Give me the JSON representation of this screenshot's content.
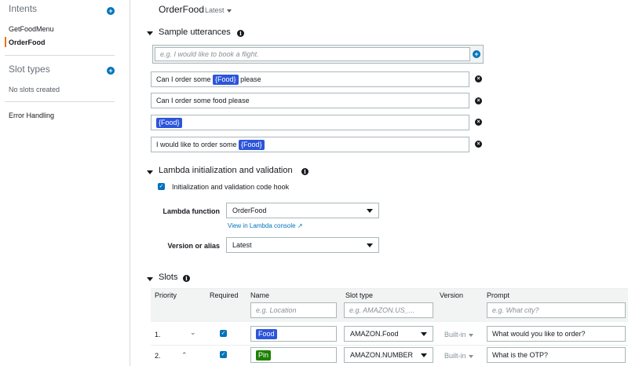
{
  "sidebar": {
    "intents_heading": "Intents",
    "intents": [
      {
        "label": "GetFoodMenu",
        "active": false
      },
      {
        "label": "OrderFood",
        "active": true
      }
    ],
    "slot_types_heading": "Slot types",
    "no_slots_note": "No slots created",
    "error_handling": "Error Handling",
    "add_symbol": "+"
  },
  "intent": {
    "title": "OrderFood",
    "version": "Latest"
  },
  "utterances_section": {
    "title": "Sample utterances",
    "placeholder": "e.g. I would like to book a flight.",
    "items": [
      {
        "before": "Can I order some ",
        "slot": "{Food}",
        "after": " please"
      },
      {
        "before": "Can I order some food please",
        "slot": "",
        "after": ""
      },
      {
        "before": "",
        "slot": "{Food}",
        "after": ""
      },
      {
        "before": "I would like to order some ",
        "slot": "{Food}",
        "after": ""
      }
    ]
  },
  "lambda_section": {
    "title": "Lambda initialization and validation",
    "hook_label": "Initialization and validation code hook",
    "hook_checked": true,
    "function_label": "Lambda function",
    "function_value": "OrderFood",
    "console_link": "View in Lambda console",
    "version_label": "Version or alias",
    "version_value": "Latest"
  },
  "slots_section": {
    "title": "Slots",
    "columns": {
      "priority": "Priority",
      "required": "Required",
      "name": "Name",
      "slot_type": "Slot type",
      "version": "Version",
      "prompt": "Prompt"
    },
    "placeholders": {
      "name": "e.g. Location",
      "slot_type": "e.g. AMAZON.US_...",
      "prompt": "e.g. What city?"
    },
    "rows": [
      {
        "priority": "1.",
        "chevron": "⌄",
        "required": true,
        "name": "Food",
        "name_color": "#2c55db",
        "slot_type": "AMAZON.Food",
        "version": "Built-in",
        "prompt": "What would you like to order?"
      },
      {
        "priority": "2.",
        "chevron": "⌃",
        "required": true,
        "name": "Pin",
        "name_color": "#1d8102",
        "slot_type": "AMAZON.NUMBER",
        "version": "Built-in",
        "prompt": "What is the OTP?"
      }
    ]
  },
  "colors": {
    "accent": "#0073bb",
    "active_bar": "#ec7211",
    "slot_blue": "#2c55db",
    "slot_green": "#1d8102"
  }
}
